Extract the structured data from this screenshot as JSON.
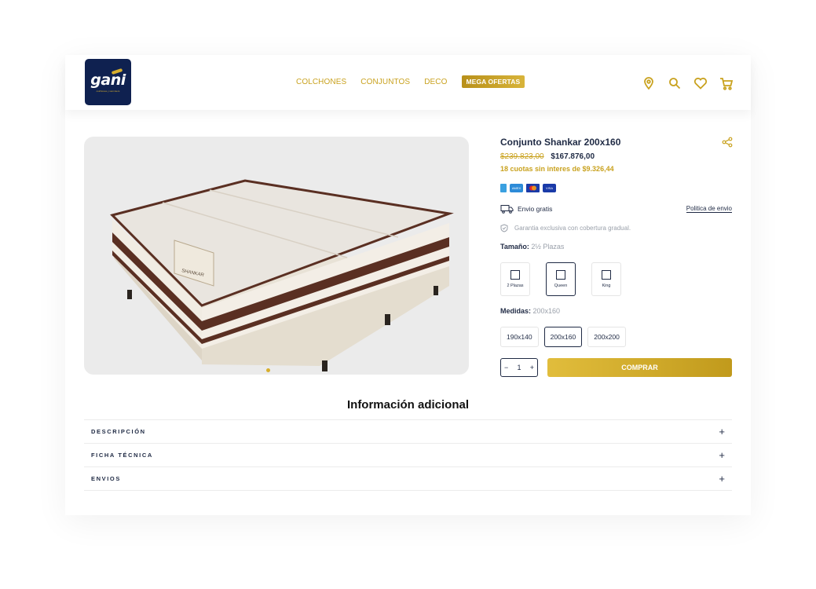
{
  "brand": {
    "name": "gani",
    "tagline": "colchones y sommiers",
    "colors": {
      "gold": "#c9a21f",
      "navy": "#0f2150",
      "text": "#1f2a44"
    }
  },
  "nav": {
    "items": [
      "COLCHONES",
      "CONJUNTOS",
      "DECO"
    ],
    "mega_label": "MEGA OFERTAS"
  },
  "header_icons": [
    "location-pin-icon",
    "search-icon",
    "heart-icon",
    "cart-icon"
  ],
  "product": {
    "title": "Conjunto Shankar 200x160",
    "old_price": "$239.823,00",
    "price": "$167.876,00",
    "installments": "18 cuotas sin interes de $9.326,44",
    "payment_methods": [
      "mercadopago",
      "amex",
      "mastercard",
      "visa"
    ],
    "shipping_label": "Envio gratis",
    "shipping_policy_link": "Politica de envio",
    "warranty": "Garantia exclusiva con cobertura gradual.",
    "size_label": "Tamaño:",
    "size_value": "2½ Plazas",
    "sizes": [
      {
        "label": "2 Plazas",
        "selected": false
      },
      {
        "label": "Queen",
        "selected": true
      },
      {
        "label": "King",
        "selected": false
      }
    ],
    "measure_label": "Medidas:",
    "measure_value": "200x160",
    "measures": [
      {
        "label": "190x140",
        "selected": false
      },
      {
        "label": "200x160",
        "selected": true
      },
      {
        "label": "200x200",
        "selected": false
      }
    ],
    "qty_minus": "−",
    "qty": "1",
    "qty_plus": "+",
    "buy_label": "COMPRAR",
    "image_label": "SHANKAR"
  },
  "additional": {
    "title": "Información adicional",
    "sections": [
      "DESCRIPCIÓN",
      "FICHA TÉCNICA",
      "ENVIOS"
    ],
    "expand_symbol": "+"
  }
}
